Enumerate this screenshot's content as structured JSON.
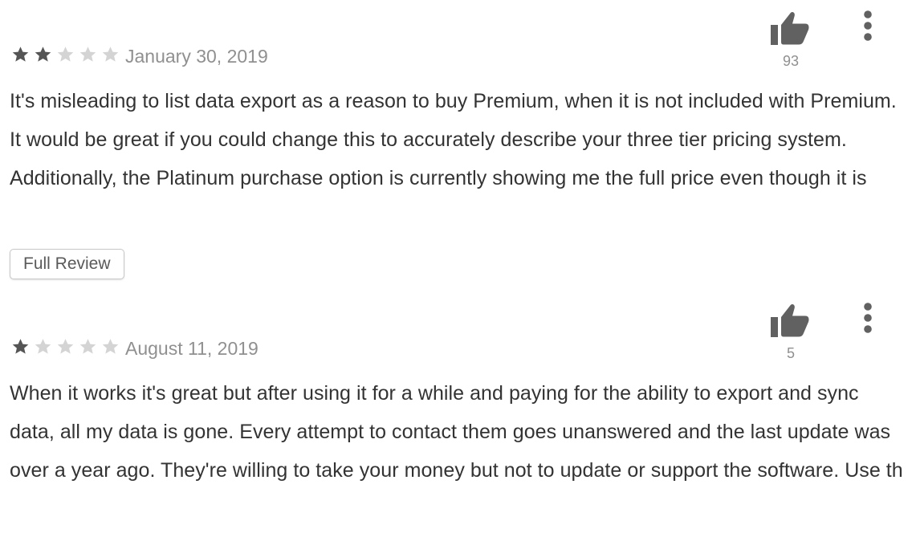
{
  "colors": {
    "star_filled": "#555555",
    "star_empty": "#d4d4d4",
    "icon": "#616161",
    "muted_text": "#909090",
    "body_text": "#333333"
  },
  "reviews": [
    {
      "rating": 2,
      "max_rating": 5,
      "date": "January 30, 2019",
      "helpful_count": "93",
      "text": "It's misleading to list data export as a reason to buy Premium, when it is not included with Premium. It would be great if you could change this to accurately describe your three tier pricing system. Additionally, the Platinum purchase option is currently showing me the full price even though it is",
      "button_label": "Full Review",
      "thumb_icon": "thumbs-up-icon",
      "menu_icon": "more-vert-icon"
    },
    {
      "rating": 1,
      "max_rating": 5,
      "date": "August 11, 2019",
      "helpful_count": "5",
      "text": "When it works it's great but after using it for a while and paying for the ability to export and sync data, all my data is gone. Every attempt to contact them goes unanswered and the last update was over a year ago. They're willing to take your money but not to update or support the software. Use th",
      "thumb_icon": "thumbs-up-icon",
      "menu_icon": "more-vert-icon"
    }
  ]
}
